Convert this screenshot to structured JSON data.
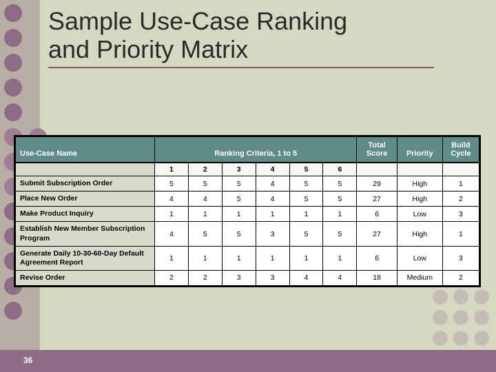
{
  "title_line1": "Sample Use-Case Ranking",
  "title_line2": "and Priority Matrix",
  "page_number": "36",
  "table": {
    "headers": {
      "name": "Use-Case Name",
      "ranking": "Ranking Criteria, 1 to 5",
      "score": "Total Score",
      "priority": "Priority",
      "cycle": "Build Cycle"
    },
    "criteria_cols": [
      "1",
      "2",
      "3",
      "4",
      "5",
      "6"
    ],
    "rows": [
      {
        "name": "Submit Subscription Order",
        "vals": [
          "5",
          "5",
          "5",
          "4",
          "5",
          "5"
        ],
        "score": "29",
        "priority": "High",
        "cycle": "1"
      },
      {
        "name": "Place New Order",
        "vals": [
          "4",
          "4",
          "5",
          "4",
          "5",
          "5"
        ],
        "score": "27",
        "priority": "High",
        "cycle": "2"
      },
      {
        "name": "Make Product Inquiry",
        "vals": [
          "1",
          "1",
          "1",
          "1",
          "1",
          "1"
        ],
        "score": "6",
        "priority": "Low",
        "cycle": "3"
      },
      {
        "name": "Establish New Member Subscription Program",
        "vals": [
          "4",
          "5",
          "5",
          "3",
          "5",
          "5"
        ],
        "score": "27",
        "priority": "High",
        "cycle": "1"
      },
      {
        "name": "Generate Daily 10-30-60-Day Default Agreement Report",
        "vals": [
          "1",
          "1",
          "1",
          "1",
          "1",
          "1"
        ],
        "score": "6",
        "priority": "Low",
        "cycle": "3"
      },
      {
        "name": "Revise Order",
        "vals": [
          "2",
          "2",
          "3",
          "3",
          "4",
          "4"
        ],
        "score": "18",
        "priority": "Medium",
        "cycle": "2"
      }
    ]
  }
}
